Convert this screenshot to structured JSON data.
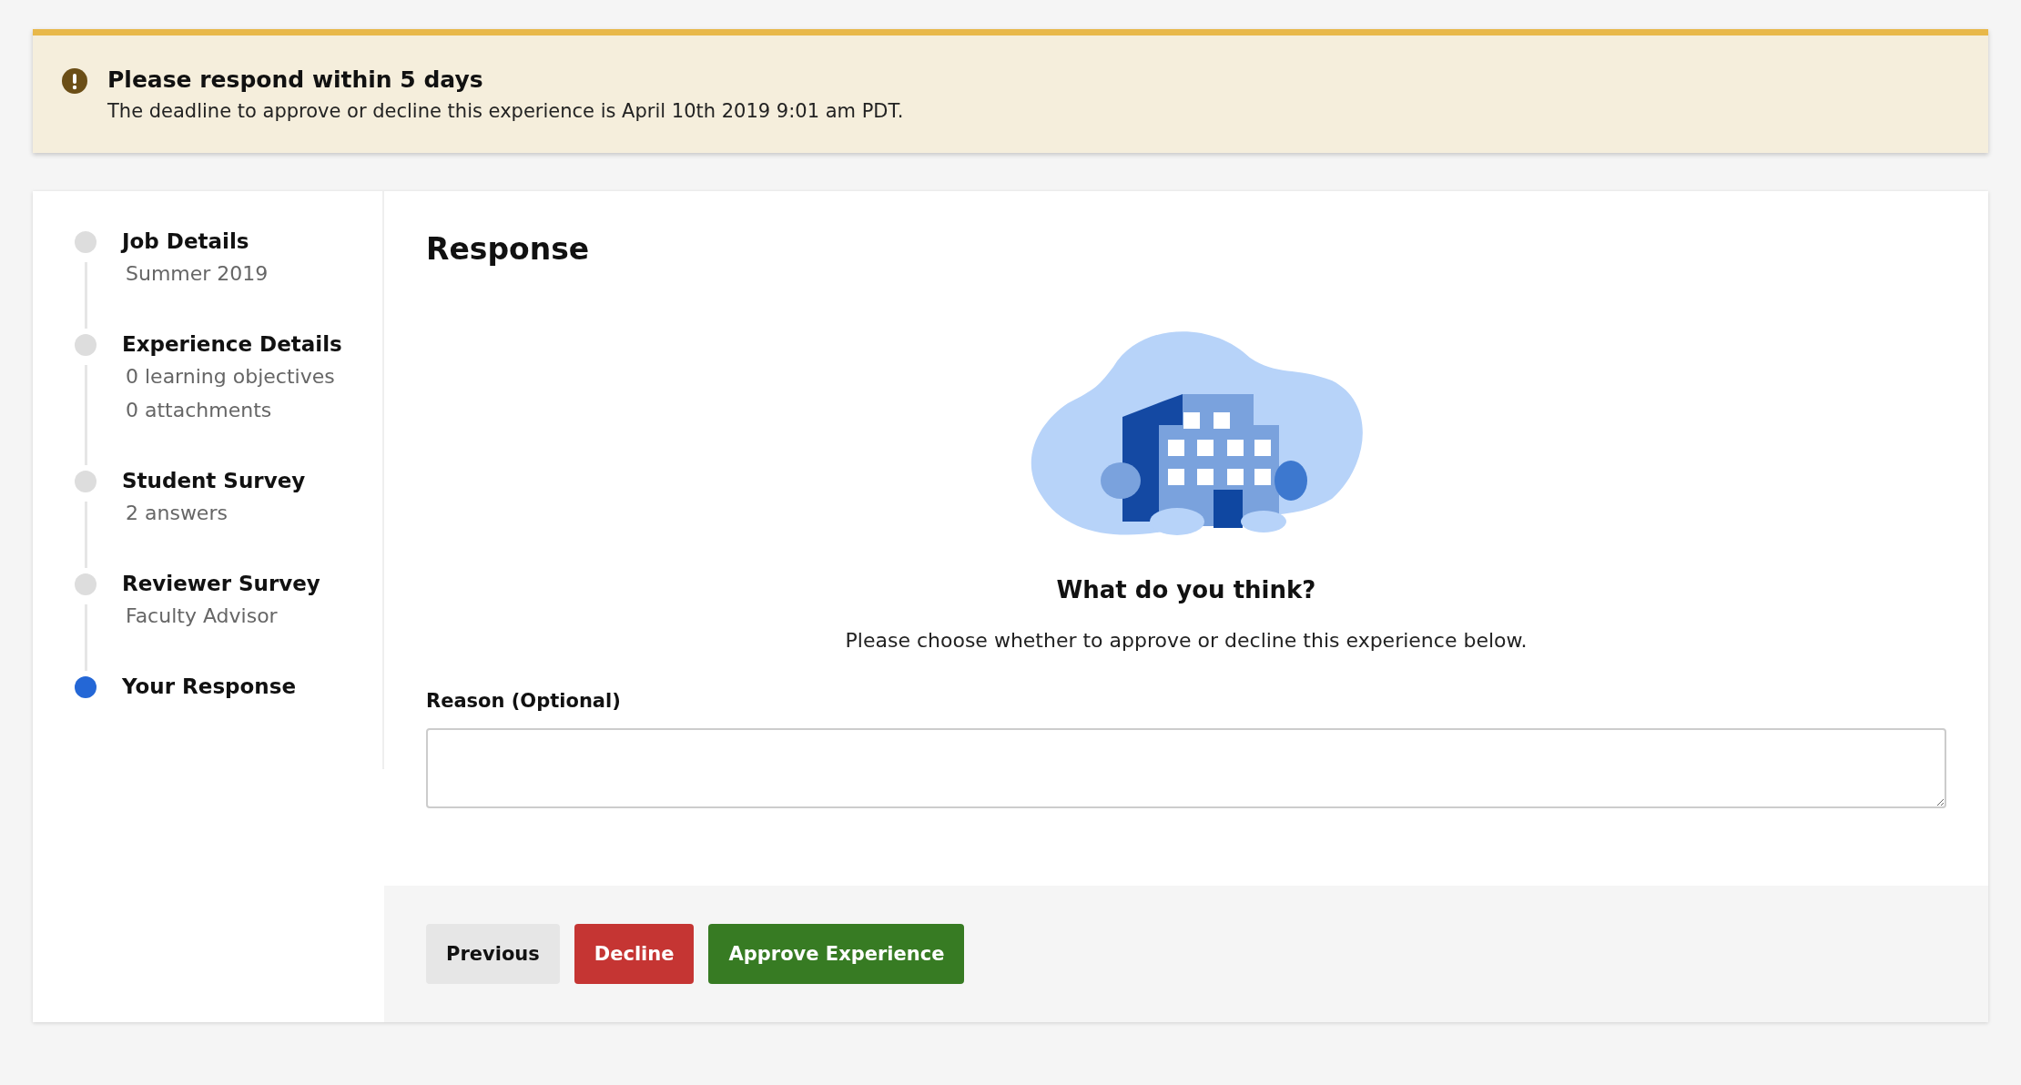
{
  "alert": {
    "title": "Please respond within 5 days",
    "message": "The deadline to approve or decline this experience is April 10th 2019 9:01 am PDT."
  },
  "steps": [
    {
      "title": "Job Details",
      "details": [
        "Summer 2019"
      ],
      "selected": false
    },
    {
      "title": "Experience Details",
      "details": [
        "0 learning objectives",
        "0 attachments"
      ],
      "selected": false
    },
    {
      "title": "Student Survey",
      "details": [
        "2 answers"
      ],
      "selected": false
    },
    {
      "title": "Reviewer Survey",
      "details": [
        "Faculty Advisor"
      ],
      "selected": false
    },
    {
      "title": "Your Response",
      "selected": true
    }
  ],
  "response": {
    "heading": "Response",
    "question": "What do you think?",
    "instructions": "Please choose whether to approve or decline this experience below.",
    "reason_label": "Reason (Optional)"
  },
  "buttons": [
    {
      "label": "Previous",
      "kind": "secondary"
    },
    {
      "label": "Decline",
      "kind": "danger"
    },
    {
      "label": "Approve Experience",
      "kind": "primary"
    }
  ]
}
